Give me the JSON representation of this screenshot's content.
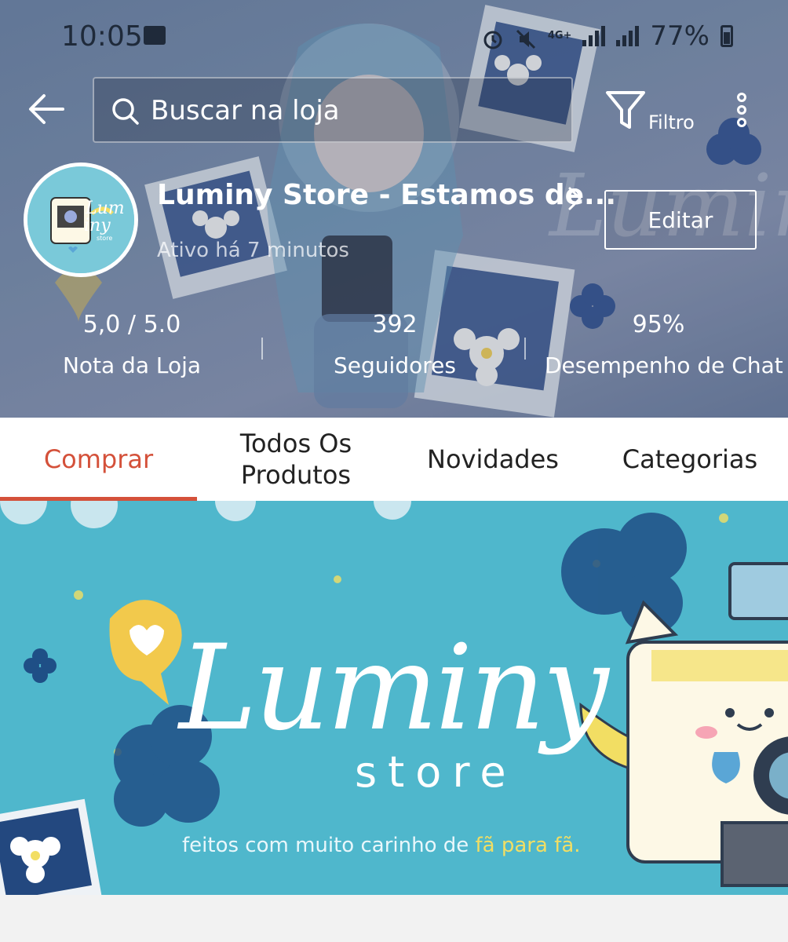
{
  "status_bar": {
    "time": "10:05",
    "network": "4G+",
    "battery": "77%"
  },
  "search": {
    "placeholder": "Buscar na loja"
  },
  "filter": {
    "label": "Filtro"
  },
  "store": {
    "name": "Luminy Store - Estamos de...",
    "active_status": "Ativo há 7 minutos",
    "edit_label": "Editar",
    "avatar_label": "Lum iny store"
  },
  "stats": [
    {
      "value": "5,0 / 5.0",
      "label": "Nota da Loja"
    },
    {
      "value": "392",
      "label": "Seguidores"
    },
    {
      "value": "95%",
      "label": "Desempenho de Chat"
    }
  ],
  "tabs": [
    {
      "label": "Comprar",
      "active": true
    },
    {
      "label": "Todos Os Produtos",
      "active": false
    },
    {
      "label": "Novidades",
      "active": false
    },
    {
      "label": "Categorias",
      "active": false
    }
  ],
  "banner": {
    "brand": "Luminy",
    "brand_sub": "store",
    "tagline_prefix": "feitos com muito carinho de ",
    "tagline_highlight": "fã para fã."
  },
  "colors": {
    "accent": "#d4513a",
    "banner_bg": "#4fb7cc"
  }
}
